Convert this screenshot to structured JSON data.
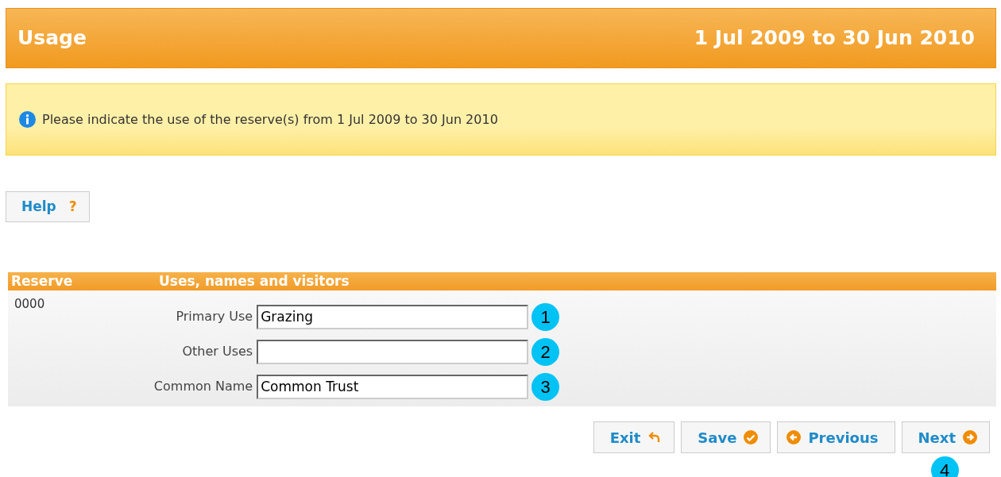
{
  "header": {
    "title": "Usage",
    "period": "1 Jul 2009 to 30 Jun 2010"
  },
  "notice": {
    "text": "Please indicate the use of the reserve(s) from 1 Jul 2009 to 30 Jun 2010"
  },
  "help_button": {
    "label": "Help",
    "mark": "?"
  },
  "table": {
    "columns": [
      "Reserve",
      "Uses, names and visitors"
    ],
    "rows": [
      {
        "reserve": "0000",
        "fields": [
          {
            "label": "Primary Use",
            "value": "Grazing",
            "callout": "1"
          },
          {
            "label": "Other Uses",
            "callout": "2"
          },
          {
            "label": "Common Name",
            "value": "Common Trust",
            "callout": "3"
          }
        ]
      }
    ]
  },
  "buttons": [
    {
      "kind": "exit",
      "label": "Exit"
    },
    {
      "kind": "save",
      "label": "Save"
    },
    {
      "kind": "previous",
      "label": "Previous"
    },
    {
      "kind": "next",
      "label": "Next",
      "callout": "4"
    }
  ]
}
